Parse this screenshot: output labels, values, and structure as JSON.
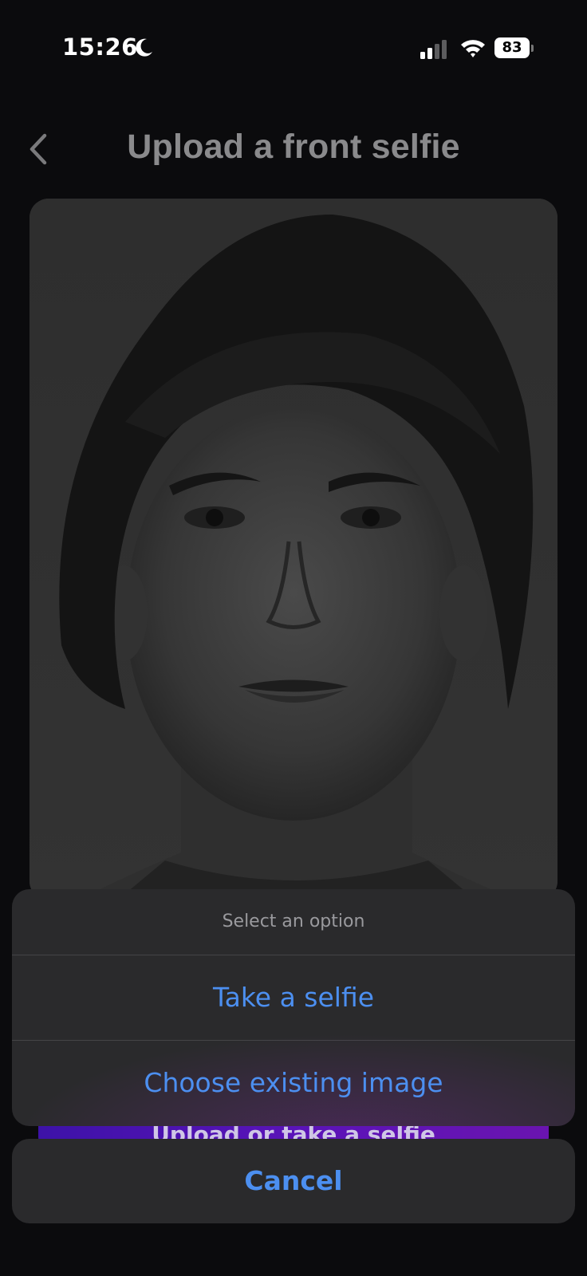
{
  "status_bar": {
    "time": "15:26",
    "battery_level": "83",
    "icons": [
      "moon-icon",
      "cellular-signal-icon",
      "wifi-icon",
      "battery-icon"
    ]
  },
  "header": {
    "title": "Upload a front selfie",
    "back_icon": "chevron-left-icon"
  },
  "background_button": {
    "label": "Upload or take a selfie"
  },
  "action_sheet": {
    "title": "Select an option",
    "options": [
      {
        "label": "Take a selfie"
      },
      {
        "label": "Choose existing image"
      }
    ],
    "cancel_label": "Cancel"
  },
  "colors": {
    "background": "#0b0b0d",
    "sheet": "#2a2a2c",
    "accent": "#4c8ff0",
    "title_dimmed": "#8a8a8c"
  }
}
